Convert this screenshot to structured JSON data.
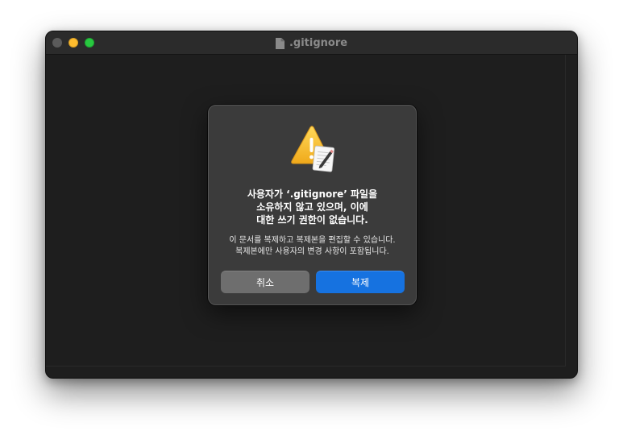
{
  "window": {
    "title": ".gitignore",
    "title_icon": "document-icon"
  },
  "dialog": {
    "icon": "warning-document-icon",
    "headline_lines": [
      "사용자가 ‘.gitignore’ 파일을",
      "소유하지 않고 있으며, 이에",
      "대한 쓰기 권한이 없습니다."
    ],
    "info_lines": [
      "이 문서를 복제하고 복제본을 편집할 수 있습니다.",
      "복제본에만 사용자의 변경 사항이 포함됩니다."
    ],
    "cancel_label": "취소",
    "duplicate_label": "복제"
  },
  "colors": {
    "window_bg": "#1e1e1e",
    "titlebar_bg": "#2b2b2b",
    "dialog_bg": "#3b3b3b",
    "cancel_button": "#6e6e6e",
    "primary_button": "#1672e0",
    "minimize": "#febc2e",
    "zoom": "#28c840",
    "close_inactive": "#5b5b5b"
  }
}
